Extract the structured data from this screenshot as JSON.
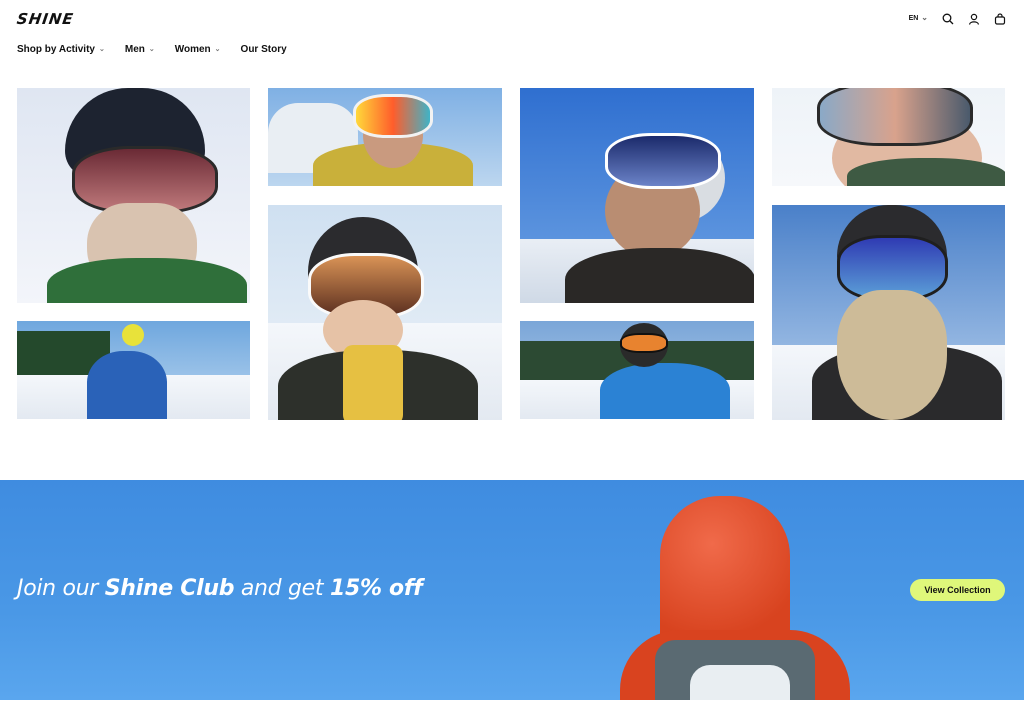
{
  "brand": {
    "logo_text": "SHINE"
  },
  "header": {
    "language": "EN",
    "icons": [
      "search-icon",
      "user-icon",
      "bag-icon"
    ]
  },
  "nav": {
    "items": [
      {
        "label": "Shop by Activity",
        "has_dropdown": true
      },
      {
        "label": "Men",
        "has_dropdown": true
      },
      {
        "label": "Women",
        "has_dropdown": true
      },
      {
        "label": "Our Story",
        "has_dropdown": false
      }
    ]
  },
  "gallery": {
    "photos": [
      "skier-helmet-snowy-beard",
      "skier-mirrored-goggles-gondola",
      "skier-laughing-white-goggles",
      "skier-mirrored-goggles-closeup",
      "skier-blue-jacket-chairlift",
      "kid-black-helmet-goggles",
      "skier-blue-jacket-orange-goggles",
      "skier-blue-goggles-fake-beard"
    ]
  },
  "promo": {
    "text_prefix": "Join our ",
    "text_bold1": "Shine Club",
    "text_middle": " and get ",
    "text_bold2": "15% off",
    "cta_label": "View Collection",
    "cta_color": "#dff77a",
    "background_color": "#4a98e6"
  }
}
